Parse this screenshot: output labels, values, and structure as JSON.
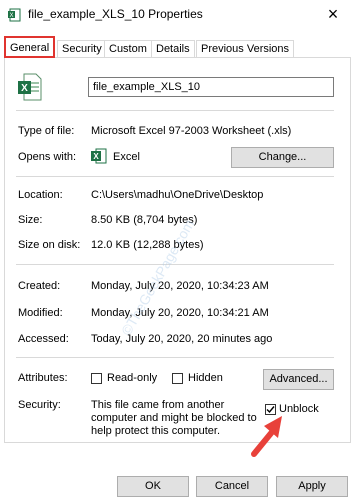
{
  "window": {
    "title": "file_example_XLS_10 Properties",
    "close_glyph": "×"
  },
  "tabs": [
    {
      "label": "General",
      "active": true
    },
    {
      "label": "Security",
      "active": false
    },
    {
      "label": "Custom",
      "active": false
    },
    {
      "label": "Details",
      "active": false
    },
    {
      "label": "Previous Versions",
      "active": false
    }
  ],
  "general": {
    "file_name": "file_example_XLS_10",
    "type_label": "Type of file:",
    "type_value": "Microsoft Excel 97-2003 Worksheet (.xls)",
    "opens_label": "Opens with:",
    "opens_value": "Excel",
    "change_button": "Change...",
    "location_label": "Location:",
    "location_value": "C:\\Users\\madhu\\OneDrive\\Desktop",
    "size_label": "Size:",
    "size_value": "8.50 KB (8,704 bytes)",
    "size_on_disk_label": "Size on disk:",
    "size_on_disk_value": "12.0 KB (12,288 bytes)",
    "created_label": "Created:",
    "created_value": "Monday, July 20, 2020, 10:34:23 AM",
    "modified_label": "Modified:",
    "modified_value": "Monday, July 20, 2020, 10:34:21 AM",
    "accessed_label": "Accessed:",
    "accessed_value": "Today, July 20, 2020, 20 minutes ago",
    "attributes_label": "Attributes:",
    "readonly_label": "Read-only",
    "hidden_label": "Hidden",
    "advanced_button": "Advanced...",
    "security_label": "Security:",
    "security_line1": "This file came from another",
    "security_line2": "computer and might be blocked to",
    "security_line3": "help protect this computer.",
    "unblock_label": "Unblock",
    "unblock_checked": true
  },
  "footer": {
    "ok": "OK",
    "cancel": "Cancel",
    "apply": "Apply"
  },
  "watermark": "©TheGeekPage.com",
  "colors": {
    "highlight_red": "#e0342f",
    "excel_green": "#1e7145",
    "arrow_red": "#e8413a"
  }
}
